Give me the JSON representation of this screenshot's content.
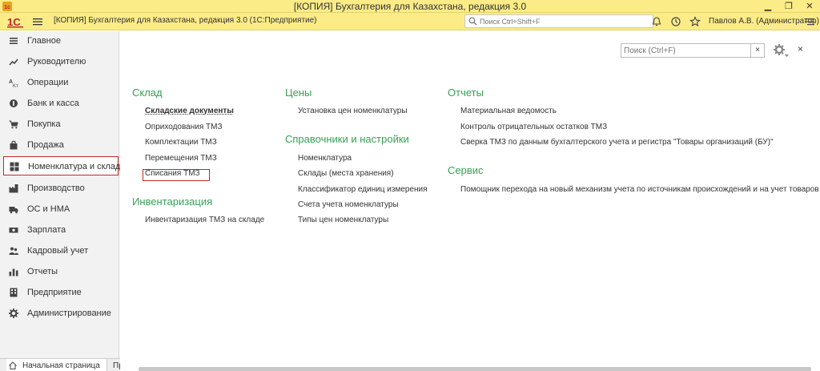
{
  "window": {
    "title": "[КОПИЯ] Бухгалтерия для Казахстана, редакция 3.0",
    "minimize": "▁",
    "maximize": "❐",
    "close": "✕"
  },
  "toolbar": {
    "logo_text": "1С",
    "breadcrumb": "[КОПИЯ] Бухгалтерия для Казахстана, редакция 3.0  (1С:Предприятие)",
    "search_placeholder": "Поиск Ctrl+Shift+F",
    "user": "Павлов А.В. (Администратор)",
    "icons": [
      "bell-icon",
      "history-icon",
      "star-icon",
      "settings-menu-icon"
    ]
  },
  "sidebar": {
    "items": [
      {
        "label": "Главное",
        "icon": "list-icon"
      },
      {
        "label": "Руководителю",
        "icon": "trend-icon"
      },
      {
        "label": "Операции",
        "icon": "operations-icon"
      },
      {
        "label": "Банк и касса",
        "icon": "coin-icon"
      },
      {
        "label": "Покупка",
        "icon": "cart-icon"
      },
      {
        "label": "Продажа",
        "icon": "bag-icon"
      },
      {
        "label": "Номенклатура и склад",
        "icon": "grid-icon",
        "active": true
      },
      {
        "label": "Производство",
        "icon": "factory-icon"
      },
      {
        "label": "ОС и НМА",
        "icon": "truck-icon"
      },
      {
        "label": "Зарплата",
        "icon": "money-icon"
      },
      {
        "label": "Кадровый учет",
        "icon": "people-icon"
      },
      {
        "label": "Отчеты",
        "icon": "chart-icon"
      },
      {
        "label": "Предприятие",
        "icon": "building-icon"
      },
      {
        "label": "Администрирование",
        "icon": "gear-icon"
      }
    ]
  },
  "main": {
    "search_placeholder": "Поиск (Ctrl+F)",
    "clear": "×",
    "close": "×",
    "sklad": {
      "title": "Склад",
      "links": [
        "Складские документы",
        "Оприходования ТМЗ",
        "Комплектации ТМЗ",
        "Перемещения ТМЗ",
        "Списания ТМЗ"
      ]
    },
    "inventory": {
      "title": "Инвентаризация",
      "links": [
        "Инвентаризация ТМЗ на складе"
      ]
    },
    "prices": {
      "title": "Цены",
      "links": [
        "Установка цен номенклатуры"
      ]
    },
    "refs": {
      "title": "Справочники и настройки",
      "links": [
        "Номенклатура",
        "Склады (места хранения)",
        "Классификатор единиц измерения",
        "Счета учета номенклатуры",
        "Типы цен номенклатуры"
      ]
    },
    "reports": {
      "title": "Отчеты",
      "links": [
        "Материальная ведомость",
        "Контроль отрицательных остатков ТМЗ",
        "Сверка ТМЗ по данным бухгалтерского учета и регистра \"Товары организаций (БУ)\""
      ]
    },
    "service": {
      "title": "Сервис",
      "links": [
        "Помощник перехода на новый механизм учета по источникам происхождений и на учет товаров в"
      ]
    }
  },
  "bottom": {
    "tab1": "Начальная страница",
    "tab2": "Пр"
  },
  "colors": {
    "accent_yellow": "#FBEC88",
    "section_green": "#38A056",
    "highlight_red": "#C0272D"
  }
}
